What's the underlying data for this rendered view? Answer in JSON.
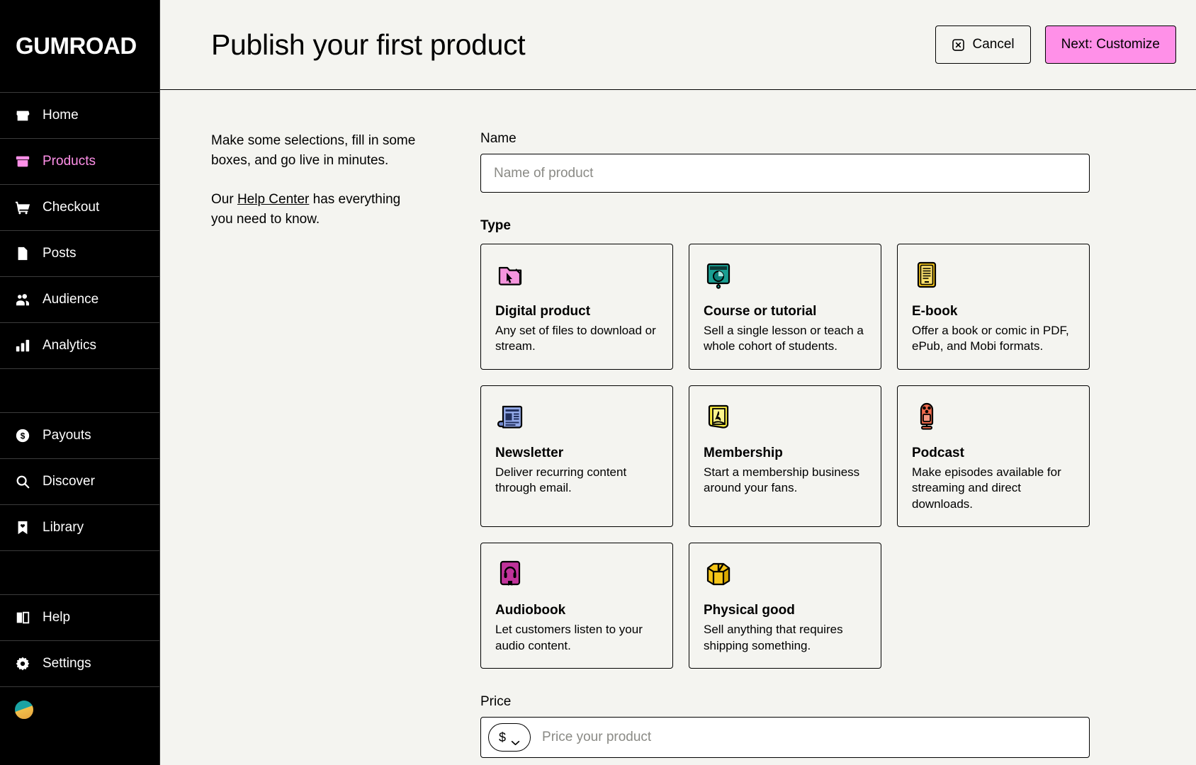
{
  "sidebar": {
    "logo": "GUMROAD",
    "items": [
      {
        "label": "Home",
        "icon": "store-icon",
        "active": false
      },
      {
        "label": "Products",
        "icon": "box-icon",
        "active": true
      },
      {
        "label": "Checkout",
        "icon": "cart-icon",
        "active": false
      },
      {
        "label": "Posts",
        "icon": "document-icon",
        "active": false
      },
      {
        "label": "Audience",
        "icon": "people-icon",
        "active": false
      },
      {
        "label": "Analytics",
        "icon": "bar-chart-icon",
        "active": false
      },
      {
        "label": "Payouts",
        "icon": "dollar-circle-icon",
        "active": false
      },
      {
        "label": "Discover",
        "icon": "search-icon",
        "active": false
      },
      {
        "label": "Library",
        "icon": "bookmark-heart-icon",
        "active": false
      },
      {
        "label": "Help",
        "icon": "book-icon",
        "active": false
      },
      {
        "label": "Settings",
        "icon": "gear-icon",
        "active": false
      }
    ]
  },
  "header": {
    "title": "Publish your first product",
    "cancel_label": "Cancel",
    "next_label": "Next: Customize",
    "accent_color": "#ff90e8"
  },
  "blurb": {
    "line1": "Make some selections, fill in some boxes, and go live in minutes.",
    "line2_prefix": "Our ",
    "link": "Help Center",
    "line2_suffix": " has everything you need to know."
  },
  "form": {
    "name_label": "Name",
    "name_placeholder": "Name of product",
    "type_label": "Type",
    "price_label": "Price",
    "price_placeholder": "Price your product",
    "currency_symbol": "$"
  },
  "types": [
    {
      "name": "Digital product",
      "desc": "Any set of files to download or stream.",
      "icon": "folder-cursor-icon",
      "color": "#f595dd"
    },
    {
      "name": "Course or tutorial",
      "desc": "Sell a single lesson or teach a whole cohort of students.",
      "icon": "presentation-chart-icon",
      "color": "#199e92"
    },
    {
      "name": "E-book",
      "desc": "Offer a book or comic in PDF, ePub, and Mobi formats.",
      "icon": "ebook-icon",
      "color": "#f5c518"
    },
    {
      "name": "Newsletter",
      "desc": "Deliver recurring content through email.",
      "icon": "newspaper-icon",
      "color": "#93a9e8"
    },
    {
      "name": "Membership",
      "desc": "Start a membership business around your fans.",
      "icon": "membership-icon",
      "color": "#f7ea3f"
    },
    {
      "name": "Podcast",
      "desc": "Make episodes available for streaming and direct downloads.",
      "icon": "microphone-icon",
      "color": "#ef6a4c"
    },
    {
      "name": "Audiobook",
      "desc": "Let customers listen to your audio content.",
      "icon": "audiobook-icon",
      "color": "#c0339a"
    },
    {
      "name": "Physical good",
      "desc": "Sell anything that requires shipping something.",
      "icon": "package-box-icon",
      "color": "#f5c518"
    }
  ]
}
